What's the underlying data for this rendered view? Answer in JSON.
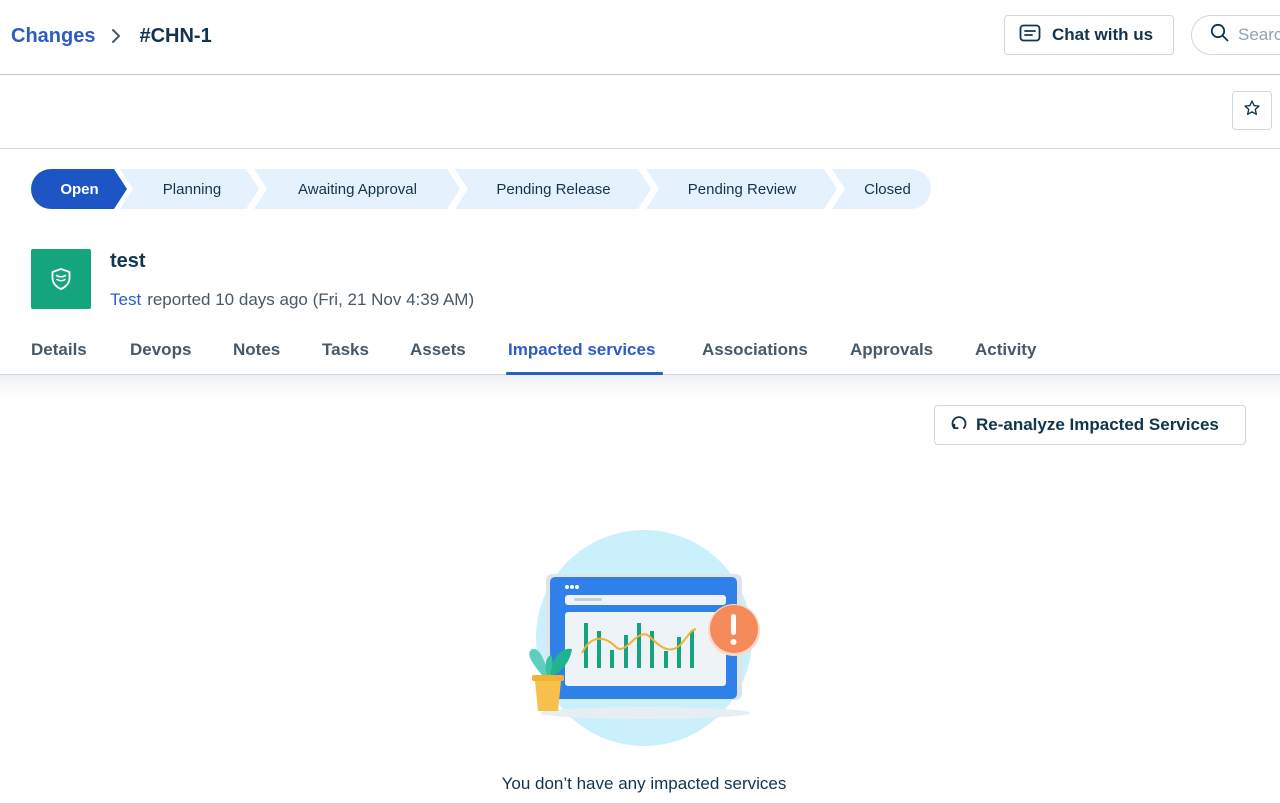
{
  "breadcrumb": {
    "parent": "Changes",
    "current": "#CHN-1"
  },
  "header": {
    "chat_label": "Chat with us",
    "search_placeholder": "Search"
  },
  "pipeline": {
    "stages": [
      "Open",
      "Planning",
      "Awaiting Approval",
      "Pending Release",
      "Pending Review",
      "Closed"
    ],
    "active": "Open"
  },
  "ticket": {
    "title": "test",
    "reporter": "Test",
    "reported_text": "reported 10 days ago (Fri, 21 Nov 4:39 AM)"
  },
  "tabs": [
    "Details",
    "Devops",
    "Notes",
    "Tasks",
    "Assets",
    "Impacted services",
    "Associations",
    "Approvals",
    "Activity"
  ],
  "active_tab": "Impacted services",
  "actions": {
    "reanalyze_label": "Re-analyze Impacted Services"
  },
  "empty_state": {
    "message": "You don’t have any impacted services"
  },
  "colors": {
    "primary": "#2c5cc5",
    "active_stage": "#1d56c4",
    "stage_bg": "#e5f2fd",
    "ticket_icon_bg": "#14a57e",
    "alert_orange": "#f58b5b"
  },
  "icons": [
    "chevron-right-icon",
    "chat-icon",
    "search-icon",
    "star-icon",
    "change-shield-icon",
    "refresh-icon"
  ]
}
